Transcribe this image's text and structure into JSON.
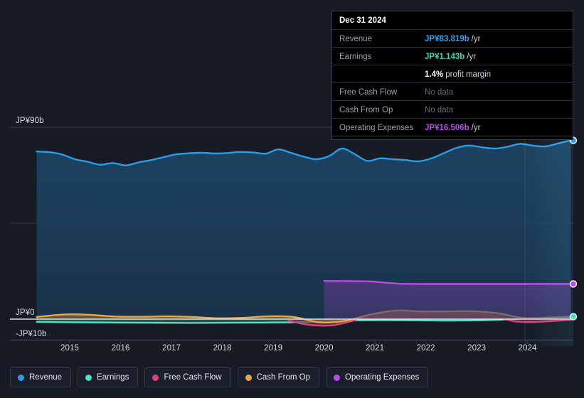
{
  "chart_data": {
    "type": "area",
    "title": "",
    "xlabel": "",
    "ylabel": "",
    "currency": "JP¥",
    "grid": true,
    "legend_position": "bottom",
    "xlim": [
      2014.3,
      2024.9
    ],
    "ylim": [
      -10,
      90
    ],
    "y_ticks": [
      {
        "value": 90,
        "label": "JP¥90b"
      },
      {
        "value": 45,
        "label": ""
      },
      {
        "value": 0,
        "label": "JP¥0"
      },
      {
        "value": -10,
        "label": "-JP¥10b"
      }
    ],
    "x_ticks": [
      {
        "value": 2015,
        "label": "2015"
      },
      {
        "value": 2016,
        "label": "2016"
      },
      {
        "value": 2017,
        "label": "2017"
      },
      {
        "value": 2018,
        "label": "2018"
      },
      {
        "value": 2019,
        "label": "2019"
      },
      {
        "value": 2020,
        "label": "2020"
      },
      {
        "value": 2021,
        "label": "2021"
      },
      {
        "value": 2022,
        "label": "2022"
      },
      {
        "value": 2023,
        "label": "2023"
      },
      {
        "value": 2024,
        "label": "2024"
      }
    ],
    "series": [
      {
        "name": "Revenue",
        "color": "#2d9ce8",
        "fill": "#1d4565",
        "x": [
          2014.35,
          2014.6,
          2014.85,
          2015.1,
          2015.35,
          2015.6,
          2015.85,
          2016.1,
          2016.35,
          2016.6,
          2016.85,
          2017.1,
          2017.35,
          2017.6,
          2017.85,
          2018.1,
          2018.35,
          2018.6,
          2018.85,
          2019.1,
          2019.35,
          2019.6,
          2019.85,
          2020.1,
          2020.35,
          2020.6,
          2020.85,
          2021.1,
          2021.35,
          2021.6,
          2021.85,
          2022.1,
          2022.35,
          2022.6,
          2022.85,
          2023.1,
          2023.35,
          2023.6,
          2023.85,
          2024.1,
          2024.35,
          2024.6,
          2024.85
        ],
        "values": [
          78.6,
          78.3,
          77.2,
          75.0,
          73.8,
          72.4,
          73.2,
          72.1,
          73.5,
          74.6,
          76.0,
          77.3,
          77.8,
          78.0,
          77.7,
          77.9,
          78.4,
          78.2,
          77.6,
          79.6,
          78.0,
          76.2,
          75.0,
          76.5,
          80.0,
          77.4,
          74.2,
          75.4,
          75.0,
          74.6,
          74.0,
          75.3,
          77.8,
          80.3,
          81.4,
          80.6,
          80.0,
          80.8,
          82.2,
          81.4,
          81.0,
          82.4,
          83.819
        ]
      },
      {
        "name": "Earnings",
        "color": "#4fe0c0",
        "fill": "#2f6e62",
        "x": [
          2014.35,
          2015.1,
          2015.85,
          2016.6,
          2017.35,
          2018.1,
          2018.85,
          2019.6,
          2020.35,
          2021.1,
          2021.85,
          2022.6,
          2023.35,
          2024.1,
          2024.85
        ],
        "values": [
          -1.3,
          -1.5,
          -1.6,
          -1.7,
          -1.8,
          -1.7,
          -1.6,
          -1.4,
          -0.7,
          -0.5,
          -0.6,
          -0.7,
          -0.4,
          0.4,
          1.143
        ]
      },
      {
        "name": "Free Cash Flow",
        "color": "#d9447f",
        "fill": "#7a3550",
        "x": [
          2019.3,
          2019.6,
          2019.9,
          2020.2,
          2020.5,
          2020.8,
          2021.1,
          2021.4,
          2021.7,
          2022.0,
          2022.3,
          2022.6,
          2022.9,
          2023.2,
          2023.5,
          2023.8,
          2024.1,
          2024.4,
          2024.85
        ],
        "values": [
          -0.6,
          -2.3,
          -3.0,
          -2.8,
          -1.2,
          1.1,
          2.6,
          3.2,
          3.0,
          2.7,
          2.6,
          2.7,
          2.8,
          2.2,
          0.2,
          -1.2,
          -1.4,
          -1.0,
          -0.4
        ]
      },
      {
        "name": "Cash From Op",
        "color": "#e8a845",
        "fill": "#7b6233",
        "x": [
          2014.35,
          2014.9,
          2015.4,
          2015.9,
          2016.4,
          2016.9,
          2017.4,
          2017.9,
          2018.4,
          2018.9,
          2019.4,
          2019.9,
          2020.4,
          2020.9,
          2021.4,
          2021.9,
          2022.4,
          2022.9,
          2023.4,
          2023.9,
          2024.4,
          2024.85
        ],
        "values": [
          1.0,
          2.2,
          2.0,
          1.2,
          1.1,
          1.3,
          1.0,
          0.4,
          0.6,
          1.3,
          1.0,
          -1.5,
          -0.9,
          2.1,
          4.0,
          3.6,
          3.6,
          3.7,
          2.8,
          0.6,
          0.5,
          0.9
        ]
      },
      {
        "name": "Operating Expenses",
        "color": "#b84ce8",
        "fill": "#4b3a7a",
        "x": [
          2020.0,
          2020.3,
          2020.6,
          2020.9,
          2021.2,
          2021.5,
          2021.8,
          2022.1,
          2022.4,
          2022.7,
          2023.0,
          2023.3,
          2023.6,
          2023.9,
          2024.2,
          2024.5,
          2024.85
        ],
        "values": [
          17.9,
          17.9,
          17.8,
          17.7,
          17.1,
          16.6,
          16.5,
          16.5,
          16.5,
          16.5,
          16.5,
          16.5,
          16.5,
          16.5,
          16.5,
          16.5,
          16.506
        ]
      }
    ],
    "highlight_band": {
      "from": 2023.95,
      "to": 2024.9
    },
    "end_markers": [
      {
        "series": "Revenue",
        "value": 83.819
      },
      {
        "series": "Operating Expenses",
        "value": 16.506
      },
      {
        "series": "Earnings",
        "value": 1.143
      }
    ]
  },
  "tooltip": {
    "date": "Dec 31 2024",
    "rows": [
      {
        "key": "Revenue",
        "value": "JP¥83.819b",
        "unit": "/yr",
        "color": "#3aa0e8",
        "no_data": false
      },
      {
        "key": "Earnings",
        "value": "JP¥1.143b",
        "unit": "/yr",
        "color": "#3fd9b8",
        "no_data": false
      },
      {
        "key": "",
        "value": "1.4%",
        "unit": "profit margin",
        "color": "#ffffff",
        "no_data": false
      },
      {
        "key": "Free Cash Flow",
        "value": "No data",
        "unit": "",
        "color": "#666b75",
        "no_data": true
      },
      {
        "key": "Cash From Op",
        "value": "No data",
        "unit": "",
        "color": "#666b75",
        "no_data": true
      },
      {
        "key": "Operating Expenses",
        "value": "JP¥16.506b",
        "unit": "/yr",
        "color": "#b84ce8",
        "no_data": false
      }
    ]
  },
  "legend": {
    "items": [
      {
        "label": "Revenue",
        "color": "#2d9ce8"
      },
      {
        "label": "Earnings",
        "color": "#4fe0c0"
      },
      {
        "label": "Free Cash Flow",
        "color": "#d9447f"
      },
      {
        "label": "Cash From Op",
        "color": "#e8a845"
      },
      {
        "label": "Operating Expenses",
        "color": "#b84ce8"
      }
    ]
  },
  "colors": {
    "background": "#161b26",
    "grid": "#3a4152",
    "zero_line": "#e8edf5",
    "axis_text": "#d7dbe2"
  }
}
